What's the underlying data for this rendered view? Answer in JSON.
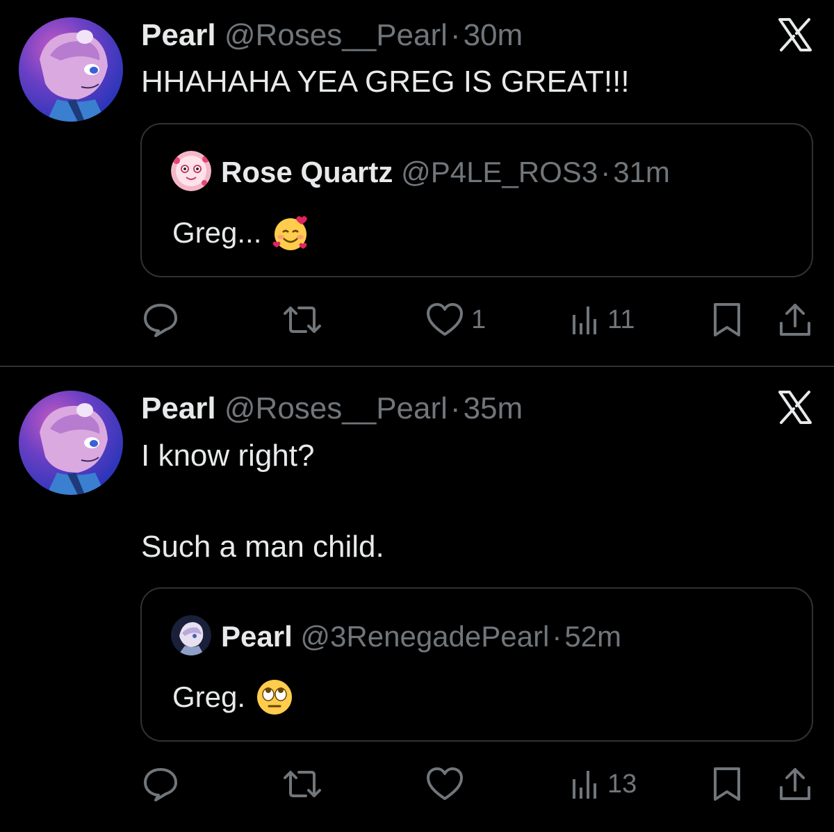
{
  "colors": {
    "background": "#000000",
    "text_primary": "#e7e9ea",
    "text_secondary": "#71767b",
    "border": "#2f3336"
  },
  "tweets": [
    {
      "author": {
        "name": "Pearl",
        "handle": "@Roses__Pearl",
        "time": "30m"
      },
      "body": "HHAHAHA YEA GREG IS GREAT!!!",
      "quote": {
        "author": {
          "name": "Rose Quartz",
          "handle": "@P4LE_ROS3",
          "time": "31m"
        },
        "text": "Greg...",
        "emoji": "smiling-face-with-hearts"
      },
      "actions": {
        "likes": "1",
        "views": "11"
      }
    },
    {
      "author": {
        "name": "Pearl",
        "handle": "@Roses__Pearl",
        "time": "35m"
      },
      "body_line1": "I know right?",
      "body_line2": "Such a man child.",
      "quote": {
        "author": {
          "name": "Pearl",
          "handle": "@3RenegadePearl",
          "time": "52m"
        },
        "text": "Greg.",
        "emoji": "face-with-rolling-eyes"
      },
      "actions": {
        "likes": "",
        "views": "13"
      }
    }
  ],
  "separator": "·"
}
